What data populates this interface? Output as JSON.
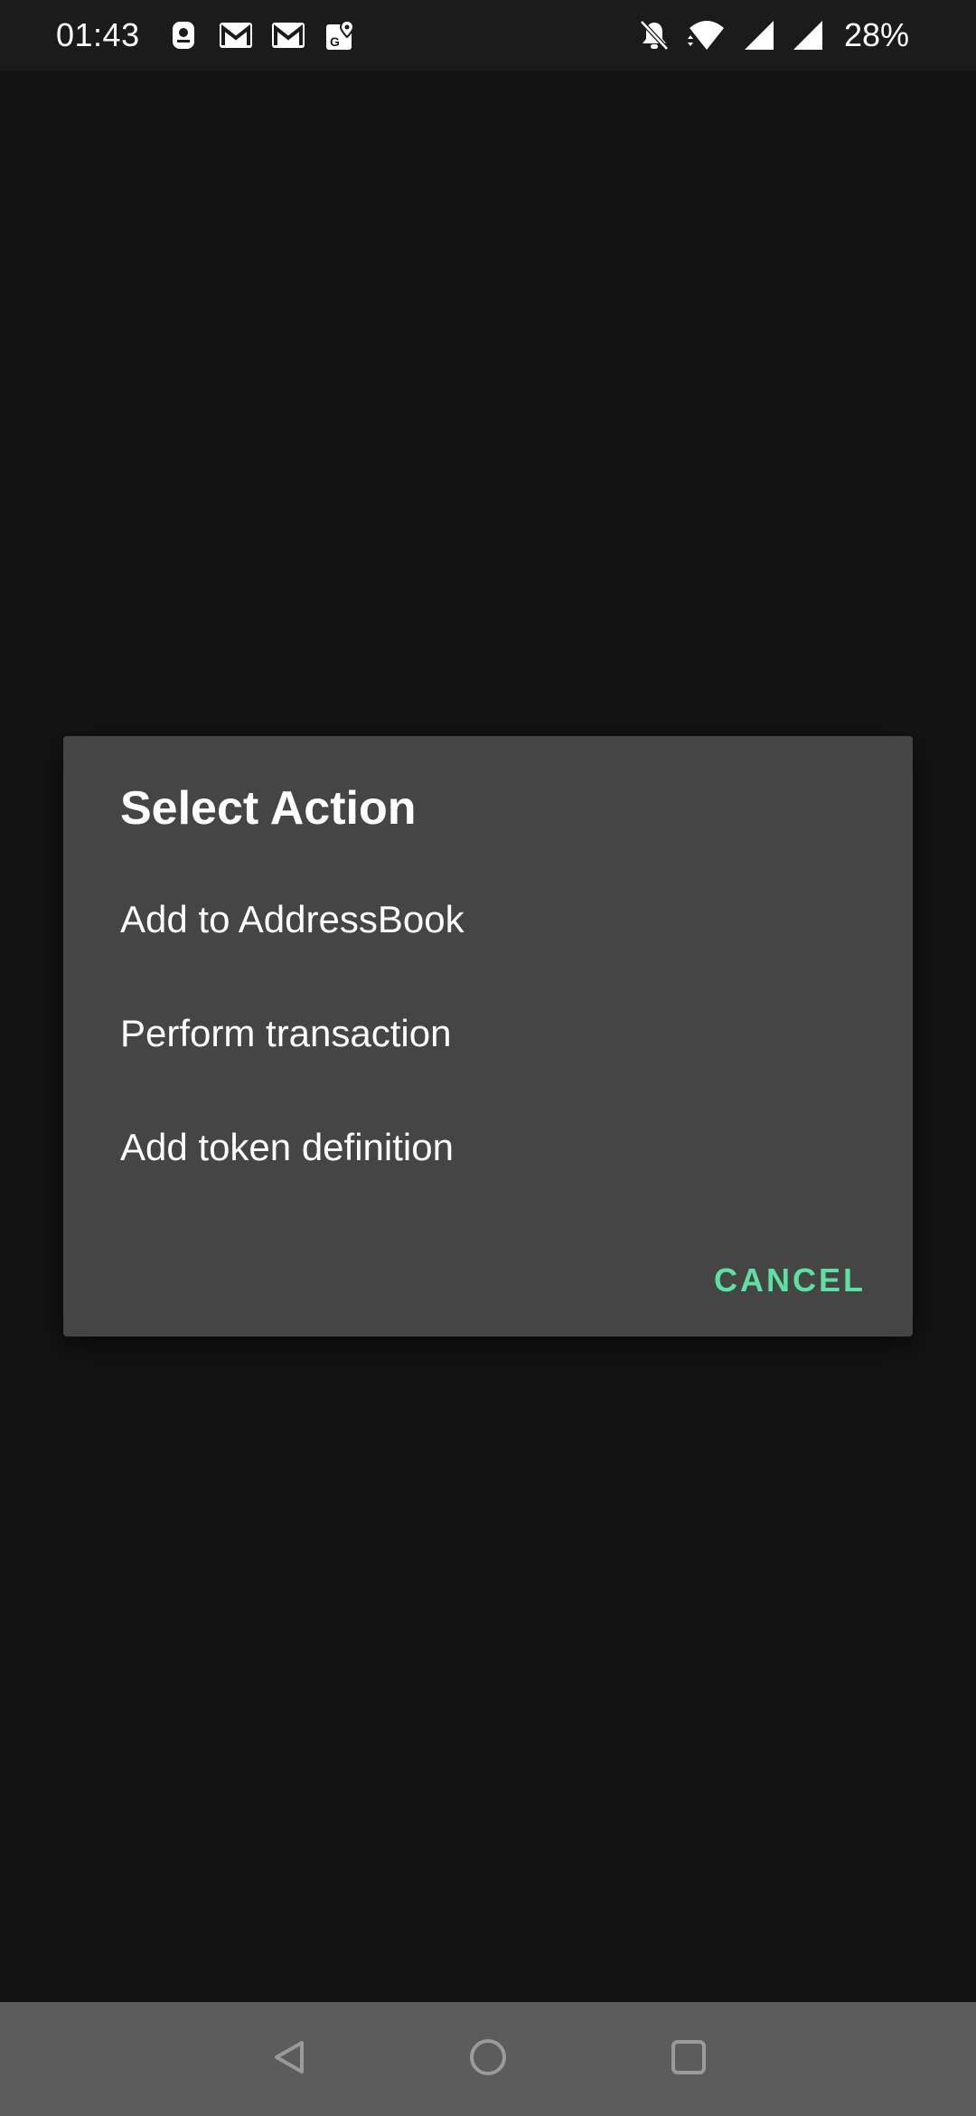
{
  "status_bar": {
    "time": "01:43",
    "left_icons": [
      "lock-app-icon",
      "gmail-icon",
      "gmail-icon",
      "maps-icon"
    ],
    "right_icons": [
      "bell-off-icon",
      "wifi-icon",
      "signal-icon",
      "signal-icon"
    ],
    "battery": "28%"
  },
  "dialog": {
    "title": "Select Action",
    "items": [
      {
        "label": "Add to AddressBook"
      },
      {
        "label": "Perform transaction"
      },
      {
        "label": "Add token definition"
      }
    ],
    "cancel_label": "CANCEL"
  },
  "colors": {
    "background": "#131313",
    "dialog_background": "#454545",
    "accent": "#5ee0a4",
    "nav_bar": "#5c5c5c"
  },
  "nav_bar": {
    "buttons": [
      "back-icon",
      "home-icon",
      "recents-icon"
    ]
  }
}
